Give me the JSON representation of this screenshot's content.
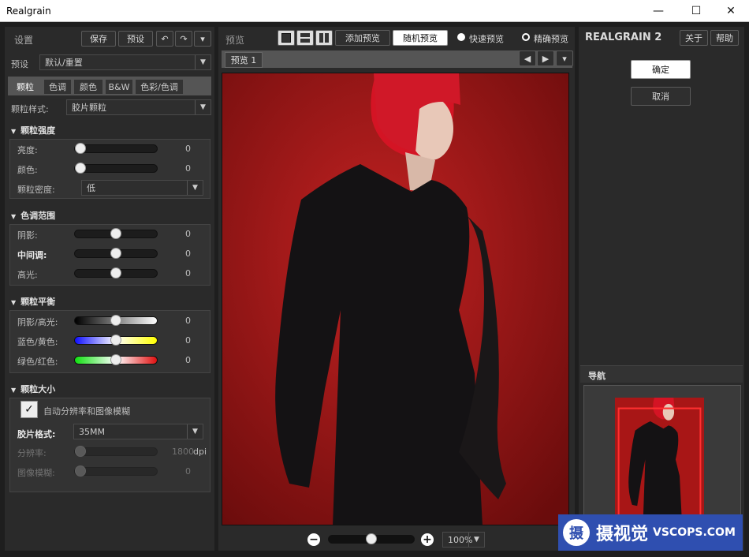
{
  "window": {
    "title": "Realgrain",
    "minimize": "—",
    "maximize": "☐",
    "close": "✕"
  },
  "left": {
    "header": "设置",
    "save": "保存",
    "preset_btn": "预设",
    "undo": "↶",
    "redo": "↷",
    "menu": "▾",
    "preset_label": "预设",
    "preset_value": "默认/重置",
    "tabs": [
      "颗粒",
      "色调",
      "颜色",
      "B&W",
      "色彩/色调"
    ],
    "grain_style_label": "颗粒样式:",
    "grain_style_value": "胶片颗粒",
    "intensity": {
      "title": "颗粒强度",
      "brightness": "亮度:",
      "brightness_val": "0",
      "color": "颜色:",
      "color_val": "0",
      "density": "颗粒密度:",
      "density_val": "低"
    },
    "tone": {
      "title": "色调范围",
      "shadow": "阴影:",
      "shadow_val": "0",
      "mid": "中间调:",
      "mid_val": "0",
      "high": "高光:",
      "high_val": "0"
    },
    "balance": {
      "title": "颗粒平衡",
      "sh": "阴影/高光:",
      "sh_val": "0",
      "by": "蓝色/黄色:",
      "by_val": "0",
      "gr": "绿色/红色:",
      "gr_val": "0"
    },
    "size": {
      "title": "颗粒大小",
      "auto": "自动分辨率和图像模糊",
      "check": "✓",
      "film_label": "胶片格式:",
      "film_value": "35MM",
      "res": "分辨率:",
      "res_val": "1800",
      "res_unit": "dpi",
      "blur": "图像模糊:",
      "blur_val": "0"
    }
  },
  "center": {
    "header": "预览",
    "add_preview": "添加预览",
    "random_preview": "随机预览",
    "fast": "快速预览",
    "accurate": "精确预览",
    "tab": "预览 1",
    "zoom": "100%",
    "zoom_minus": "−",
    "zoom_plus": "+"
  },
  "right": {
    "logo": "REALGRAIN",
    "logo_ver": "2",
    "about": "关于",
    "help": "帮助",
    "ok": "确定",
    "cancel": "取消",
    "nav": "导航"
  },
  "watermark": {
    "text": "摄视觉",
    "url": "VSCOPS.COM",
    "badge": "摄"
  },
  "colors": {
    "photo_bg": "#b01a1a",
    "accent": "#2f4fb0"
  }
}
